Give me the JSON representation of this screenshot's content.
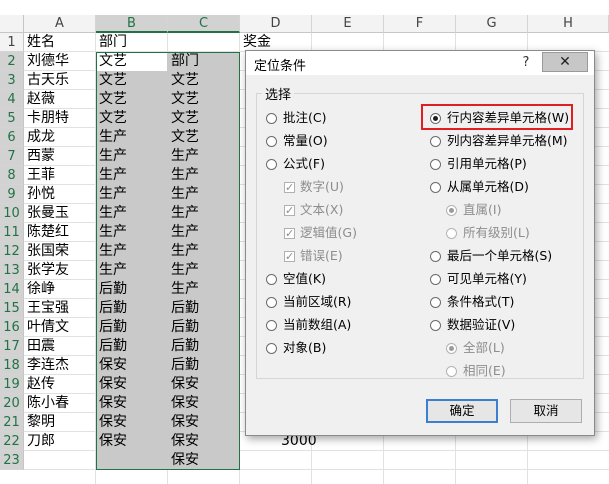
{
  "sheet": {
    "columns": [
      "A",
      "B",
      "C",
      "D",
      "E",
      "F",
      "G",
      "H"
    ],
    "rows": [
      "1",
      "2",
      "3",
      "4",
      "5",
      "6",
      "7",
      "8",
      "9",
      "10",
      "11",
      "12",
      "13",
      "14",
      "15",
      "16",
      "17",
      "18",
      "19",
      "20",
      "21",
      "22",
      "23"
    ],
    "col_a": [
      "姓名",
      "刘德华",
      "古天乐",
      "赵薇",
      "卡朋特",
      "成龙",
      "西蒙",
      "王菲",
      "孙悦",
      "张曼玉",
      "陈楚红",
      "张国荣",
      "张学友",
      "徐峥",
      "王宝强",
      "叶倩文",
      "田震",
      "李连杰",
      "赵传",
      "陈小春",
      "黎明",
      "刀郎",
      ""
    ],
    "col_b": [
      "部门",
      "文艺",
      "文艺",
      "文艺",
      "文艺",
      "生产",
      "生产",
      "生产",
      "生产",
      "生产",
      "生产",
      "生产",
      "生产",
      "后勤",
      "后勤",
      "后勤",
      "后勤",
      "保安",
      "保安",
      "保安",
      "保安",
      "保安",
      ""
    ],
    "col_c": [
      "",
      "部门",
      "文艺",
      "文艺",
      "文艺",
      "文艺",
      "生产",
      "生产",
      "生产",
      "生产",
      "生产",
      "生产",
      "生产",
      "生产",
      "后勤",
      "后勤",
      "后勤",
      "后勤",
      "保安",
      "保安",
      "保安",
      "保安",
      "保安"
    ],
    "d1": "奖金",
    "d22": "3000"
  },
  "dialog": {
    "title": "定位条件",
    "help": "?",
    "close": "✕",
    "section": "选择",
    "left_options": [
      {
        "label": "批注(C)",
        "type": "radio",
        "checked": false,
        "disabled": false
      },
      {
        "label": "常量(O)",
        "type": "radio",
        "checked": false,
        "disabled": false
      },
      {
        "label": "公式(F)",
        "type": "radio",
        "checked": false,
        "disabled": false
      },
      {
        "label": "数字(U)",
        "type": "check",
        "checked": true,
        "disabled": true
      },
      {
        "label": "文本(X)",
        "type": "check",
        "checked": true,
        "disabled": true
      },
      {
        "label": "逻辑值(G)",
        "type": "check",
        "checked": true,
        "disabled": true
      },
      {
        "label": "错误(E)",
        "type": "check",
        "checked": true,
        "disabled": true
      },
      {
        "label": "空值(K)",
        "type": "radio",
        "checked": false,
        "disabled": false
      },
      {
        "label": "当前区域(R)",
        "type": "radio",
        "checked": false,
        "disabled": false
      },
      {
        "label": "当前数组(A)",
        "type": "radio",
        "checked": false,
        "disabled": false
      },
      {
        "label": "对象(B)",
        "type": "radio",
        "checked": false,
        "disabled": false
      }
    ],
    "right_options": [
      {
        "label": "行内容差异单元格(W)",
        "type": "radio",
        "checked": true,
        "disabled": false
      },
      {
        "label": "列内容差异单元格(M)",
        "type": "radio",
        "checked": false,
        "disabled": false
      },
      {
        "label": "引用单元格(P)",
        "type": "radio",
        "checked": false,
        "disabled": false
      },
      {
        "label": "从属单元格(D)",
        "type": "radio",
        "checked": false,
        "disabled": false
      },
      {
        "label": "直属(I)",
        "type": "radio",
        "checked": true,
        "disabled": true
      },
      {
        "label": "所有级别(L)",
        "type": "radio",
        "checked": false,
        "disabled": true
      },
      {
        "label": "最后一个单元格(S)",
        "type": "radio",
        "checked": false,
        "disabled": false
      },
      {
        "label": "可见单元格(Y)",
        "type": "radio",
        "checked": false,
        "disabled": false
      },
      {
        "label": "条件格式(T)",
        "type": "radio",
        "checked": false,
        "disabled": false
      },
      {
        "label": "数据验证(V)",
        "type": "radio",
        "checked": false,
        "disabled": false
      },
      {
        "label": "全部(L)",
        "type": "radio",
        "checked": true,
        "disabled": true
      },
      {
        "label": "相同(E)",
        "type": "radio",
        "checked": false,
        "disabled": true
      }
    ],
    "ok": "确定",
    "cancel": "取消"
  },
  "colors": {
    "accent": "#217346",
    "highlight": "#e02020",
    "selection": "#c9c9c9"
  }
}
